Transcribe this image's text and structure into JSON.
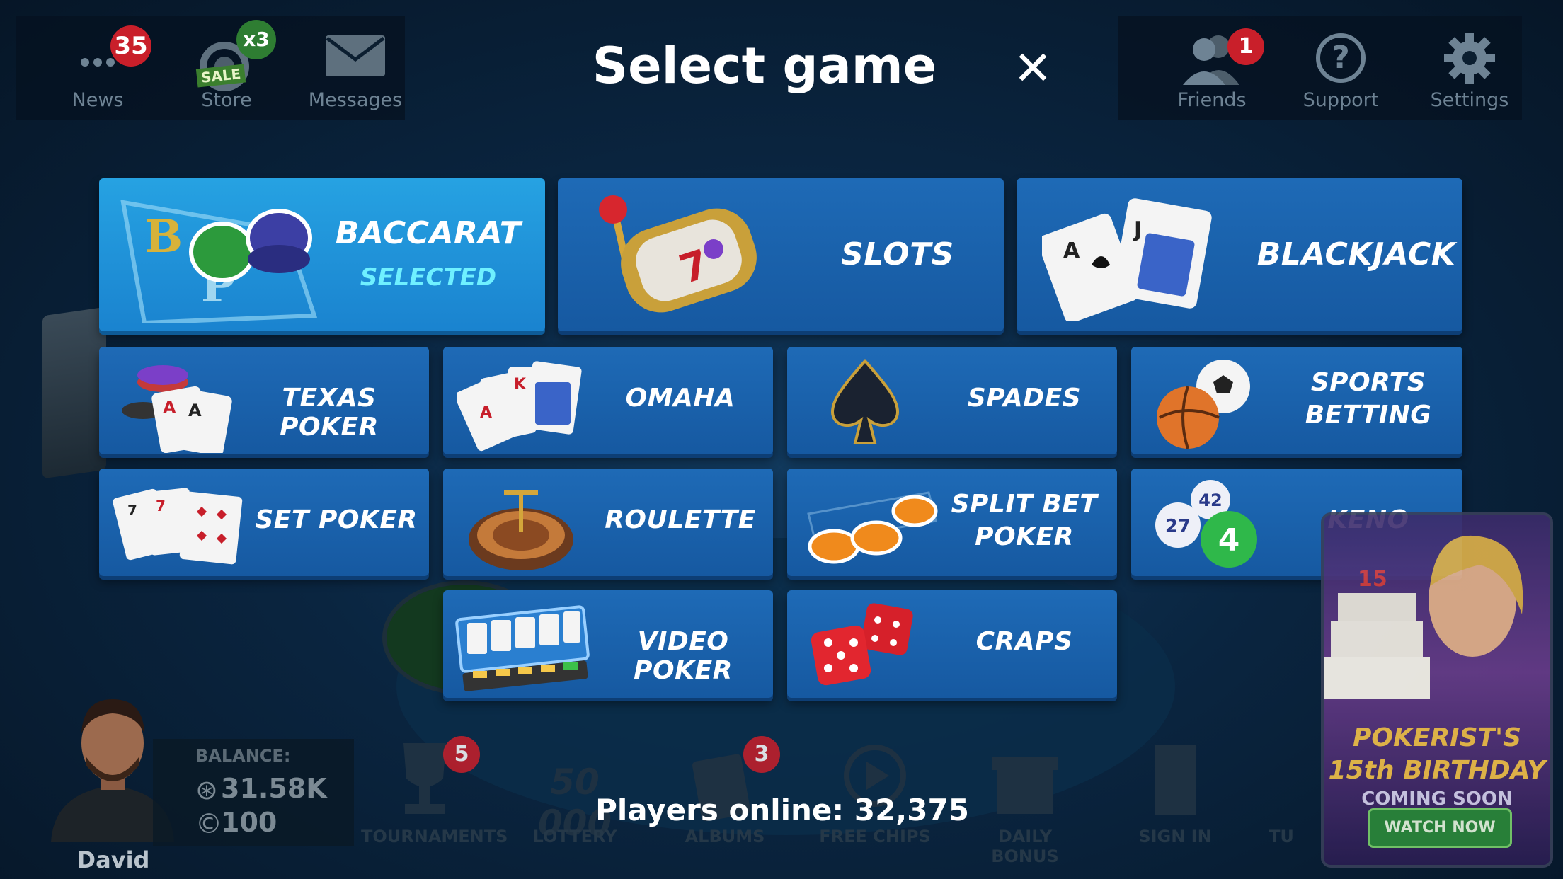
{
  "header": {
    "title": "Select game",
    "close_symbol": "✕"
  },
  "top_left": [
    {
      "label": "News",
      "badge": "35",
      "icon": "news-dots-icon"
    },
    {
      "label": "Store",
      "badge": "x3",
      "sale_tag": "SALE",
      "icon": "store-chip-icon"
    },
    {
      "label": "Messages",
      "icon": "envelope-icon"
    }
  ],
  "top_right": [
    {
      "label": "Friends",
      "badge": "1",
      "icon": "friends-icon"
    },
    {
      "label": "Support",
      "icon": "help-icon",
      "glyph": "?"
    },
    {
      "label": "Settings",
      "icon": "gear-icon"
    }
  ],
  "games_large": [
    {
      "name": "BACCARAT",
      "status": "SELECTED",
      "selected": true
    },
    {
      "name": "SLOTS",
      "selected": false
    },
    {
      "name": "BLACKJACK",
      "selected": false
    }
  ],
  "games_small": [
    {
      "name": "TEXAS POKER"
    },
    {
      "name": "OMAHA"
    },
    {
      "name": "SPADES"
    },
    {
      "name": "SPORTS",
      "name2": "BETTING"
    },
    {
      "name": "SET POKER"
    },
    {
      "name": "ROULETTE"
    },
    {
      "name": "SPLIT BET",
      "name2": "POKER"
    },
    {
      "name": "KENO",
      "balls": [
        "42",
        "27",
        "4"
      ]
    },
    {
      "name": "VIDEO POKER"
    },
    {
      "name": "CRAPS"
    }
  ],
  "footer": {
    "players_online": "Players online: 32,375"
  },
  "player": {
    "name": "David",
    "balance_label": "BALANCE:",
    "chips": "31.58K",
    "gold": "100"
  },
  "bottom_nav": [
    {
      "label": "TOURNAMENTS",
      "badge": "5"
    },
    {
      "label": "LOTTERY",
      "value": "50 000"
    },
    {
      "label": "ALBUMS",
      "badge": "3"
    },
    {
      "label": "FREE CHIPS"
    },
    {
      "label": "DAILY BONUS"
    },
    {
      "label": "SIGN IN"
    },
    {
      "label": "TU"
    }
  ],
  "promo": {
    "line1": "POKERIST'S",
    "line2": "15th BIRTHDAY",
    "line3": "COMING SOON",
    "button": "WATCH NOW",
    "cake_number": "15"
  },
  "colors": {
    "tile": "#1c63ad",
    "tile_selected": "#22a0e0",
    "selected_text": "#6ff0ff",
    "badge": "#c91f2a"
  }
}
